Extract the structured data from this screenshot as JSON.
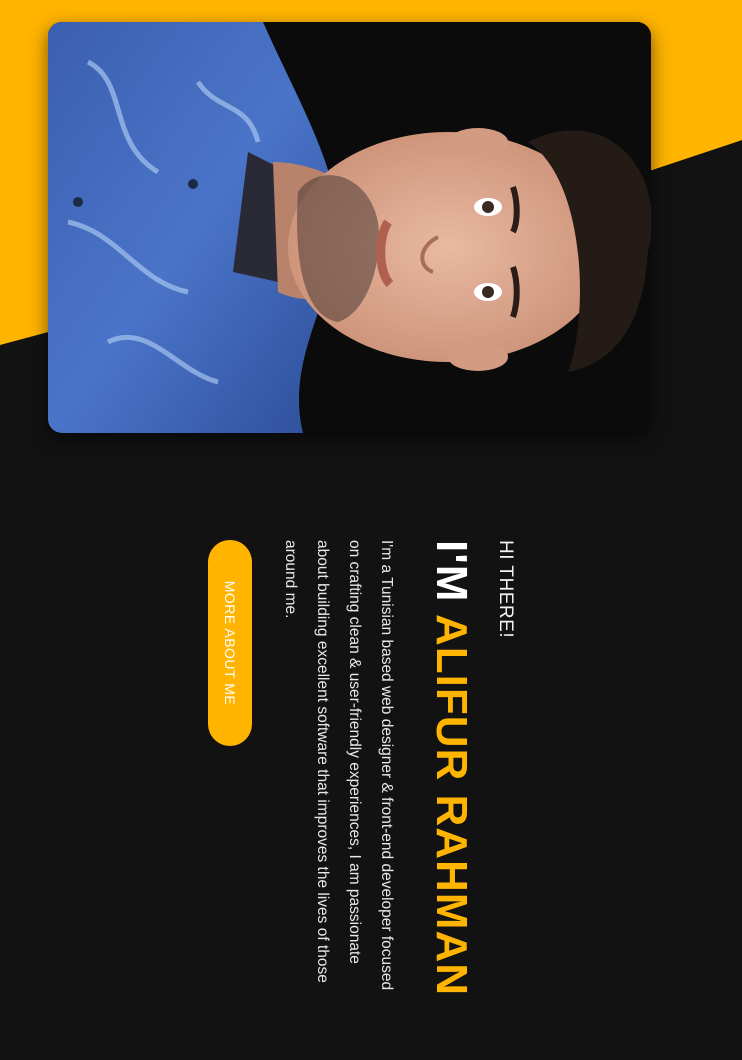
{
  "colors": {
    "accent": "#ffb400",
    "background": "#121212",
    "text": "#ffffff"
  },
  "hero": {
    "greeting": "HI THERE!",
    "headline_prefix": "I'M",
    "headline_name": "ALIFUR RAHMAN",
    "bio_lines": [
      "I'm a Tunisian based web designer & front-end developer focused",
      "on crafting clean & user-friendly experiences, I am passionate",
      "about building excellent software that improves the lives of those",
      "around me."
    ],
    "cta_label": "MORE ABOUT ME"
  },
  "photo": {
    "icon": "profile-photo"
  }
}
